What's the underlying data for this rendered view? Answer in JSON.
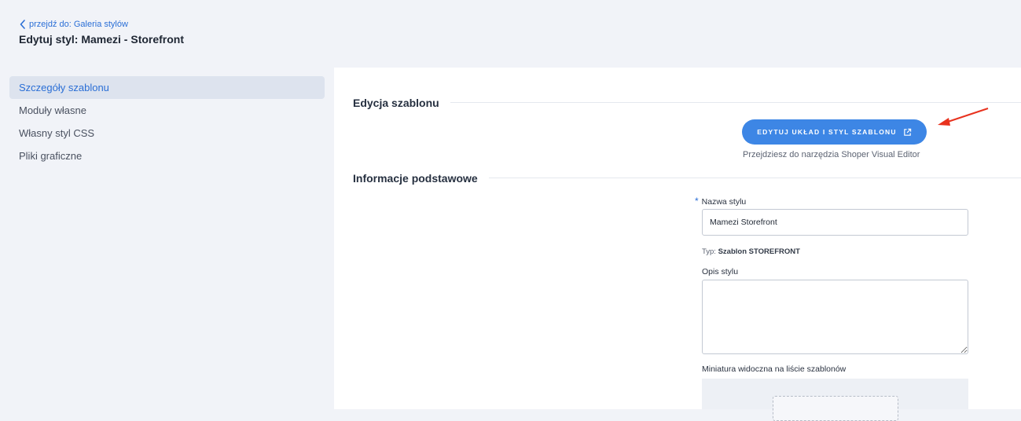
{
  "header": {
    "back_link": "przejdź do: Galeria stylów",
    "title": "Edytuj styl: Mamezi - Storefront"
  },
  "sidebar": {
    "items": [
      {
        "label": "Szczegóły szablonu",
        "active": true
      },
      {
        "label": "Moduły własne"
      },
      {
        "label": "Własny styl CSS"
      },
      {
        "label": "Pliki graficzne"
      }
    ]
  },
  "sections": {
    "edit_template": {
      "title": "Edycja szablonu",
      "button_label": "EDYTUJ UKŁAD I STYL SZABLONU",
      "hint": "Przejdziesz do narzędzia Shoper Visual Editor"
    },
    "basic_info": {
      "title": "Informacje podstawowe",
      "name_required_mark": "*",
      "name_label": "Nazwa stylu",
      "name_value": "Mamezi Storefront",
      "type_label": "Typ:",
      "type_value": "Szablon STOREFRONT",
      "description_label": "Opis stylu",
      "description_value": "",
      "thumbnail_label": "Miniatura widoczna na liście szablonów"
    }
  },
  "colors": {
    "accent": "#3d86e5",
    "arrow": "#e8321e",
    "background": "#f1f3f8"
  },
  "icons": {
    "back": "chevron-left-icon",
    "external": "external-link-icon"
  }
}
